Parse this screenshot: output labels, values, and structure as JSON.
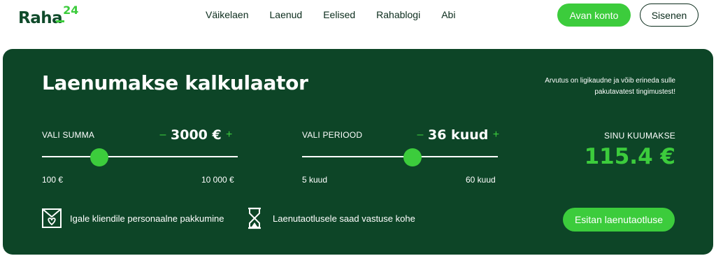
{
  "brand": {
    "name": "Raha",
    "number": "24"
  },
  "nav": {
    "items": [
      {
        "label": "Väikelaen"
      },
      {
        "label": "Laenud"
      },
      {
        "label": "Eelised"
      },
      {
        "label": "Rahablogi"
      },
      {
        "label": "Abi"
      }
    ]
  },
  "header": {
    "open_account_label": "Avan konto",
    "login_label": "Sisenen"
  },
  "calculator": {
    "title": "Laenumakse kalkulaator",
    "disclaimer": "Arvutus on ligikaudne ja võib erineda sulle pakutavatest tingimustest!",
    "amount": {
      "label": "VALI SUMMA",
      "value": "3000 €",
      "min_label": "100 €",
      "max_label": "10 000 €",
      "min": 100,
      "max": 10000,
      "current": 3000
    },
    "period": {
      "label": "VALI PERIOOD",
      "value": "36 kuud",
      "min_label": "5 kuud",
      "max_label": "60 kuud",
      "min": 5,
      "max": 60,
      "current": 36
    },
    "result": {
      "label": "SINU KUUMAKSE",
      "value": "115.4 €"
    },
    "features": [
      {
        "icon": "envelope-heart-icon",
        "text": "Igale kliendile personaalne pakkumine"
      },
      {
        "icon": "hourglass-icon",
        "text": "Laenutaotlusele saad vastuse kohe"
      }
    ],
    "apply_label": "Esitan laenutaotluse",
    "minus": "–",
    "plus": "+"
  },
  "colors": {
    "dark_green": "#0d4527",
    "accent_green": "#3ccc3c",
    "text_dark": "#0b2c1c"
  }
}
